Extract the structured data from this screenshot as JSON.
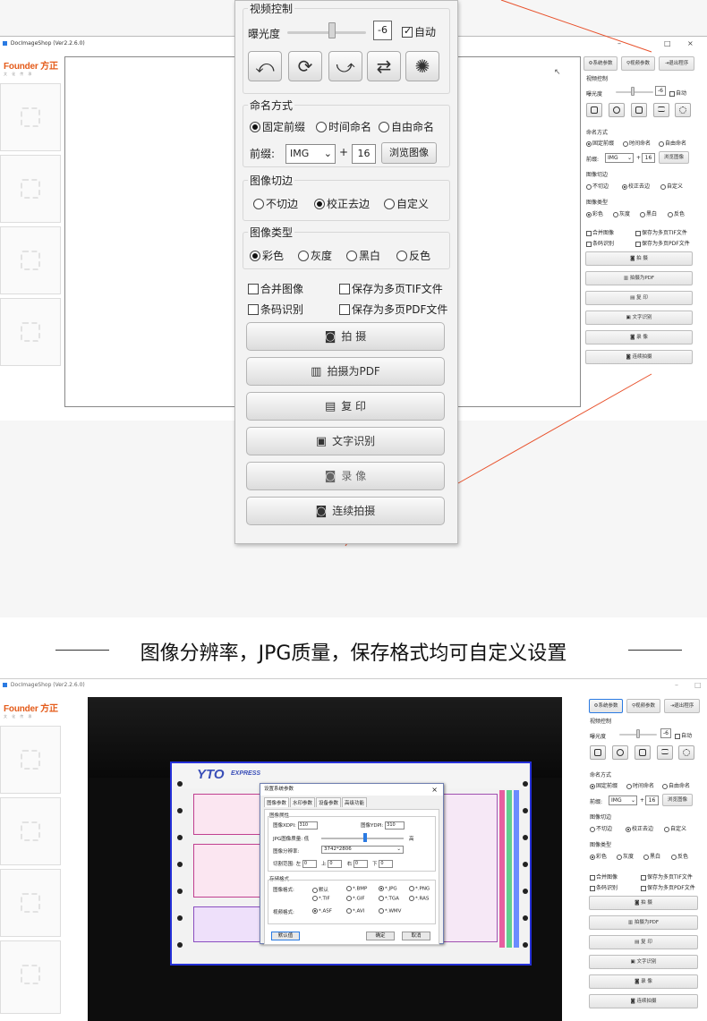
{
  "colors": {
    "accent": "#e45b1a",
    "border_blue": "#2530d8",
    "arrow_line": "#e8502a"
  },
  "top_app": {
    "title": "DocImageShop (Ver2.2.6.0)",
    "window_controls": [
      "–",
      "□",
      "×"
    ],
    "logo": {
      "brand": "Founder 方正",
      "sub": "文 化 传 承"
    }
  },
  "side_panel": {
    "header_buttons": [
      "系统参数",
      "视频参数",
      "退出程序"
    ],
    "video_label": "视频控制",
    "exposure_label": "曝光度",
    "exposure_value": "-6",
    "auto_label": "自动",
    "naming_label": "命名方式",
    "naming_options": [
      "固定前缀",
      "时间命名",
      "自由命名"
    ],
    "prefix_label": "前缀:",
    "prefix_value": "IMG",
    "plus": "+",
    "number_value": "16",
    "browse_label": "浏览图像",
    "crop_label": "图像切边",
    "crop_options": [
      "不切边",
      "校正去边",
      "自定义"
    ],
    "type_label": "图像类型",
    "type_options": [
      "彩色",
      "灰度",
      "黑白",
      "反色"
    ],
    "checks": [
      "合并图像",
      "保存为多页TIF文件",
      "条码识别",
      "保存为多页PDF文件"
    ],
    "actions": [
      "拍  摄",
      "拍摄为PDF",
      "复  印",
      "文字识别",
      "录  像",
      "连续拍摄"
    ]
  },
  "zoom_panel": {
    "video_label": "视频控制",
    "exposure_label": "曝光度",
    "exposure_value": "-6",
    "auto_label": "自动",
    "naming_label": "命名方式",
    "naming_options": [
      "固定前缀",
      "时间命名",
      "自由命名"
    ],
    "prefix_label": "前缀:",
    "prefix_value": "IMG",
    "plus": "+",
    "number_value": "16",
    "browse_label": "浏览图像",
    "crop_label": "图像切边",
    "crop_options": [
      "不切边",
      "校正去边",
      "自定义"
    ],
    "type_label": "图像类型",
    "type_options": [
      "彩色",
      "灰度",
      "黑白",
      "反色"
    ],
    "checks": [
      "合并图像",
      "保存为多页TIF文件",
      "条码识别",
      "保存为多页PDF文件"
    ],
    "actions": [
      "拍    摄",
      "拍摄为PDF",
      "复    印",
      "文字识别",
      "录    像",
      "连续拍摄"
    ]
  },
  "caption": "图像分辨率，JPG质量，保存格式均可自定义设置",
  "bottom_app": {
    "title": "DocImageShop (Ver2.2.6.0)",
    "doc_brand": "YTO",
    "doc_brand_sub": "EXPRESS",
    "dialog": {
      "title": "设置系统参数",
      "close": "×",
      "tabs": [
        "图像参数",
        "水印参数",
        "设备参数",
        "高级功能"
      ],
      "group_image": "图像属性",
      "xdpi_label": "图像XDPI:",
      "xdpi_value": "310",
      "ydpi_label": "图像YDPI:",
      "ydpi_value": "310",
      "quality_label": "JPG图像质量: 低",
      "quality_high": "高",
      "resolution_label": "图像分辨率:",
      "resolution_value": "3742*2806",
      "crop_label": "切割范围: 左",
      "crop_left": "0",
      "crop_top_label": "上",
      "crop_top": "0",
      "crop_right_label": "右",
      "crop_right": "0",
      "crop_bottom_label": "下",
      "crop_bottom": "0",
      "group_save": "存储格式",
      "format_label": "图像格式:",
      "formats": [
        "默认",
        "*.BMP",
        "*.JPG",
        "*.PNG",
        "*.TIF",
        "*.GIF",
        "*.TGA",
        "*.RAS"
      ],
      "video_format_label": "视频格式:",
      "video_formats": [
        "*.ASF",
        "*.AVI",
        "*.WMV"
      ],
      "default_btn": "默认值",
      "ok_btn": "确定",
      "cancel_btn": "取消"
    }
  }
}
